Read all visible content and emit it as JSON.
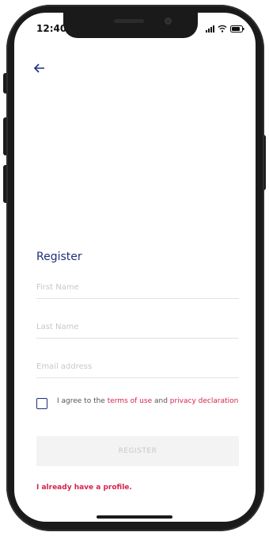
{
  "status_bar": {
    "time": "12:40",
    "icons": [
      "signal-icon",
      "wifi-icon",
      "battery-icon"
    ]
  },
  "nav": {
    "back_icon": "arrow-left-icon"
  },
  "form": {
    "title": "Register",
    "first_name": {
      "placeholder": "First Name",
      "value": ""
    },
    "last_name": {
      "placeholder": "Last Name",
      "value": ""
    },
    "email": {
      "placeholder": "Email address",
      "value": ""
    },
    "agree": {
      "checked": false,
      "prefix": "I agree to the ",
      "terms_link": "terms of use",
      "middle": " and ",
      "privacy_link": "privacy declaration"
    },
    "register_label": "REGISTER",
    "profile_link": "I already have a profile."
  },
  "colors": {
    "primary": "#1f2f7a",
    "accent": "#d4234a",
    "disabled_bg": "#f3f3f3",
    "disabled_text": "#c8c8c8",
    "frame": "#1a1a1a"
  }
}
